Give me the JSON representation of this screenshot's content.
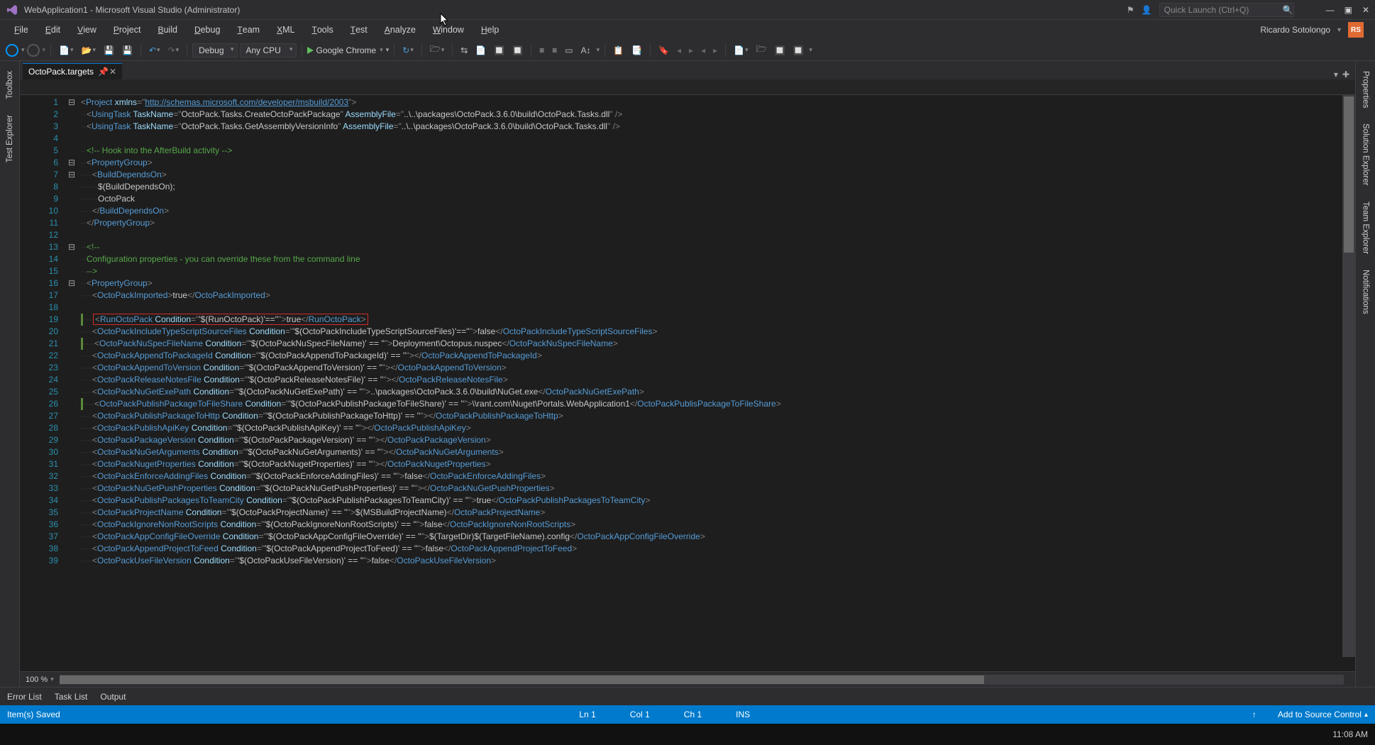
{
  "title": "WebApplication1 - Microsoft Visual Studio  (Administrator)",
  "quick_launch_placeholder": "Quick Launch (Ctrl+Q)",
  "menu": {
    "items": [
      "File",
      "Edit",
      "View",
      "Project",
      "Build",
      "Debug",
      "Team",
      "XML",
      "Tools",
      "Test",
      "Analyze",
      "Window",
      "Help"
    ]
  },
  "user": {
    "name": "Ricardo Sotolongo",
    "initials": "RS"
  },
  "toolbar": {
    "config": "Debug",
    "platform": "Any CPU",
    "run_target": "Google Chrome"
  },
  "left_tabs": [
    "Toolbox",
    "Test Explorer"
  ],
  "right_tabs": [
    "Properties",
    "Solution Explorer",
    "Team Explorer",
    "Notifications"
  ],
  "tab": {
    "name": "OctoPack.targets"
  },
  "zoom": "100 %",
  "bottom_windows": [
    "Error List",
    "Task List",
    "Output"
  ],
  "status": {
    "msg": "Item(s) Saved",
    "ln": "Ln 1",
    "col": "Col 1",
    "ch": "Ch 1",
    "ins": "INS",
    "src": "Add to Source Control"
  },
  "taskbar": {
    "time": "11:08 AM"
  },
  "lines": [
    1,
    2,
    3,
    4,
    5,
    6,
    7,
    8,
    9,
    10,
    11,
    12,
    13,
    14,
    15,
    16,
    17,
    18,
    19,
    20,
    21,
    22,
    23,
    24,
    25,
    26,
    27,
    28,
    29,
    30,
    31,
    32,
    33,
    34,
    35,
    36,
    37,
    38,
    39
  ],
  "folds": {
    "1": "⊟",
    "6": "⊟",
    "7": "⊟",
    "13": "⊟",
    "16": "⊟"
  },
  "code": {
    "1": {
      "pre": "",
      "h": "<Project xmlns=\"http://schemas.microsoft.com/developer/msbuild/2003\">"
    },
    "2": {
      "pre": "  ",
      "h": "<UsingTask TaskName=\"OctoPack.Tasks.CreateOctoPackPackage\" AssemblyFile=\"..\\..\\packages\\OctoPack.3.6.0\\build\\OctoPack.Tasks.dll\" />"
    },
    "3": {
      "pre": "  ",
      "h": "<UsingTask TaskName=\"OctoPack.Tasks.GetAssemblyVersionInfo\" AssemblyFile=\"..\\..\\packages\\OctoPack.3.6.0\\build\\OctoPack.Tasks.dll\" />"
    },
    "4": {
      "pre": "",
      "h": ""
    },
    "5": {
      "pre": "  ",
      "h": "<!-- Hook into the AfterBuild activity -->"
    },
    "6": {
      "pre": "  ",
      "h": "<PropertyGroup>"
    },
    "7": {
      "pre": "    ",
      "h": "<BuildDependsOn>"
    },
    "8": {
      "pre": "      ",
      "h": "$(BuildDependsOn);"
    },
    "9": {
      "pre": "      ",
      "h": "OctoPack"
    },
    "10": {
      "pre": "    ",
      "h": "</BuildDependsOn>"
    },
    "11": {
      "pre": "  ",
      "h": "</PropertyGroup>"
    },
    "12": {
      "pre": "",
      "h": ""
    },
    "13": {
      "pre": "  ",
      "h": "<!--"
    },
    "14": {
      "pre": "  ",
      "h": "Configuration properties - you can override these from the command line"
    },
    "15": {
      "pre": "  ",
      "h": "-->"
    },
    "16": {
      "pre": "  ",
      "h": "<PropertyGroup>"
    },
    "17": {
      "pre": "    ",
      "h": "<OctoPackImported>true</OctoPackImported>"
    },
    "18": {
      "pre": "",
      "h": ""
    },
    "19": {
      "pre": "    ",
      "h": "<RunOctoPack Condition=\"'$(RunOctoPack)'==''\">true</RunOctoPack>",
      "box": true,
      "mark": true
    },
    "20": {
      "pre": "    ",
      "h": "<OctoPackIncludeTypeScriptSourceFiles Condition=\"'$(OctoPackIncludeTypeScriptSourceFiles)'==''\">false</OctoPackIncludeTypeScriptSourceFiles>"
    },
    "21": {
      "pre": "    ",
      "h": "<OctoPackNuSpecFileName Condition=\"'$(OctoPackNuSpecFileName)' == ''\">Deployment\\Octopus.nuspec</OctoPackNuSpecFileName>",
      "mark": true
    },
    "22": {
      "pre": "    ",
      "h": "<OctoPackAppendToPackageId Condition=\"'$(OctoPackAppendToPackageId)' == ''\"></OctoPackAppendToPackageId>"
    },
    "23": {
      "pre": "    ",
      "h": "<OctoPackAppendToVersion Condition=\"'$(OctoPackAppendToVersion)' == ''\"></OctoPackAppendToVersion>"
    },
    "24": {
      "pre": "    ",
      "h": "<OctoPackReleaseNotesFile Condition=\"'$(OctoPackReleaseNotesFile)' == ''\"></OctoPackReleaseNotesFile>"
    },
    "25": {
      "pre": "    ",
      "h": "<OctoPackNuGetExePath Condition=\"'$(OctoPackNuGetExePath)' == ''\">..\\packages\\OctoPack.3.6.0\\build\\NuGet.exe</OctoPackNuGetExePath>"
    },
    "26": {
      "pre": "    ",
      "h": "<OctoPackPublishPackageToFileShare Condition=\"'$(OctoPackPublishPackageToFileShare)' == ''\">\\\\rant.com\\Nuget\\Portals.WebApplication1</OctoPackPublisPackageToFileShare>",
      "mark": true
    },
    "27": {
      "pre": "    ",
      "h": "<OctoPackPublishPackageToHttp Condition=\"'$(OctoPackPublishPackageToHttp)' == ''\"></OctoPackPublishPackageToHttp>"
    },
    "28": {
      "pre": "    ",
      "h": "<OctoPackPublishApiKey Condition=\"'$(OctoPackPublishApiKey)' == ''\"></OctoPackPublishApiKey>"
    },
    "29": {
      "pre": "    ",
      "h": "<OctoPackPackageVersion Condition=\"'$(OctoPackPackageVersion)' == ''\"></OctoPackPackageVersion>"
    },
    "30": {
      "pre": "    ",
      "h": "<OctoPackNuGetArguments Condition=\"'$(OctoPackNuGetArguments)' == ''\"></OctoPackNuGetArguments>"
    },
    "31": {
      "pre": "    ",
      "h": "<OctoPackNugetProperties Condition=\"'$(OctoPackNugetProperties)' == ''\"></OctoPackNugetProperties>"
    },
    "32": {
      "pre": "    ",
      "h": "<OctoPackEnforceAddingFiles Condition=\"'$(OctoPackEnforceAddingFiles)' == ''\">false</OctoPackEnforceAddingFiles>"
    },
    "33": {
      "pre": "    ",
      "h": "<OctoPackNuGetPushProperties Condition=\"'$(OctoPackNuGetPushProperties)' == ''\"></OctoPackNuGetPushProperties>"
    },
    "34": {
      "pre": "    ",
      "h": "<OctoPackPublishPackagesToTeamCity Condition=\"'$(OctoPackPublishPackagesToTeamCity)' == ''\">true</OctoPackPublishPackagesToTeamCity>"
    },
    "35": {
      "pre": "    ",
      "h": "<OctoPackProjectName Condition=\"'$(OctoPackProjectName)' == ''\">$(MSBuildProjectName)</OctoPackProjectName>"
    },
    "36": {
      "pre": "    ",
      "h": "<OctoPackIgnoreNonRootScripts Condition=\"'$(OctoPackIgnoreNonRootScripts)' == ''\">false</OctoPackIgnoreNonRootScripts>"
    },
    "37": {
      "pre": "    ",
      "h": "<OctoPackAppConfigFileOverride Condition=\"'$(OctoPackAppConfigFileOverride)' == ''\">$(TargetDir)$(TargetFileName).config</OctoPackAppConfigFileOverride>"
    },
    "38": {
      "pre": "    ",
      "h": "<OctoPackAppendProjectToFeed Condition=\"'$(OctoPackAppendProjectToFeed)' == ''\">false</OctoPackAppendProjectToFeed>"
    },
    "39": {
      "pre": "    ",
      "h": "<OctoPackUseFileVersion Condition=\"'$(OctoPackUseFileVersion)' == ''\">false</OctoPackUseFileVersion>"
    }
  }
}
